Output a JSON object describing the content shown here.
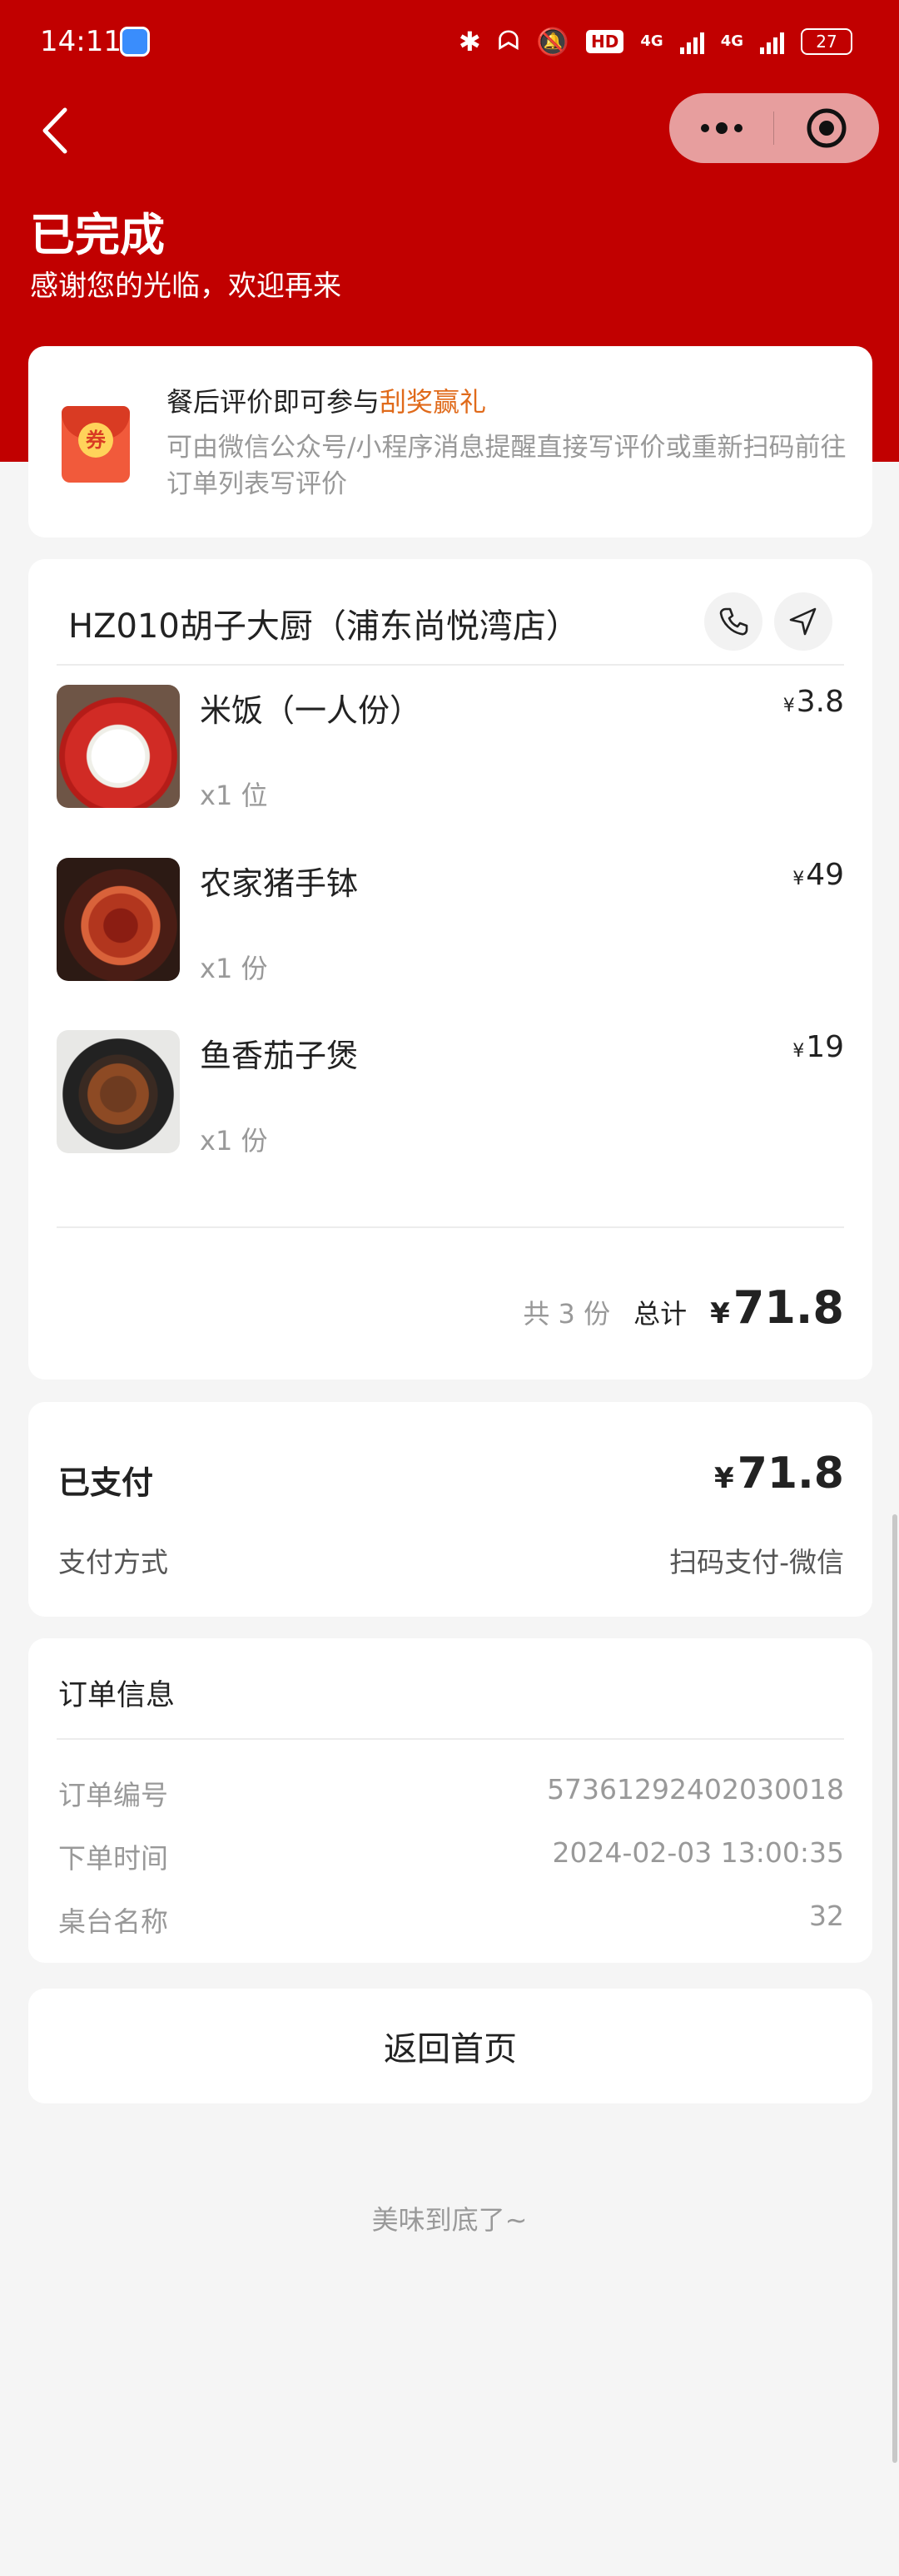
{
  "status_bar": {
    "time": "14:11",
    "network_1": "4G",
    "network_2": "4G",
    "hd": "HD",
    "battery": "27"
  },
  "header": {
    "title": "已完成",
    "subtitle": "感谢您的光临，欢迎再来"
  },
  "review": {
    "coupon_char": "券",
    "title_prefix": "餐后评价即可参与",
    "title_highlight": "刮奖赢礼",
    "desc": "可由微信公众号/小程序消息提醒直接写评价或重新扫码前往订单列表写评价"
  },
  "order": {
    "store_name": "HZ010胡子大厨（浦东尚悦湾店）",
    "currency": "¥",
    "items": [
      {
        "name": "米饭（一人份）",
        "qty": "x1 位",
        "price": "3.8"
      },
      {
        "name": "农家猪手钵",
        "qty": "x1 份",
        "price": "49"
      },
      {
        "name": "鱼香茄子煲",
        "qty": "x1 份",
        "price": "19"
      }
    ],
    "count_text": "共 3 份",
    "total_label": "总计",
    "total": "71.8"
  },
  "payment": {
    "status": "已支付",
    "amount": "71.8",
    "method_label": "支付方式",
    "method_value": "扫码支付-微信"
  },
  "order_info": {
    "title": "订单信息",
    "rows": [
      {
        "label": "订单编号",
        "value": "57361292402030018"
      },
      {
        "label": "下单时间",
        "value": "2024-02-03 13:00:35"
      },
      {
        "label": "桌台名称",
        "value": "32"
      }
    ]
  },
  "home_button": "返回首页",
  "bottom_note": "美味到底了~",
  "colors": {
    "brand_red": "#c10000",
    "highlight_orange": "#e06a1a"
  }
}
